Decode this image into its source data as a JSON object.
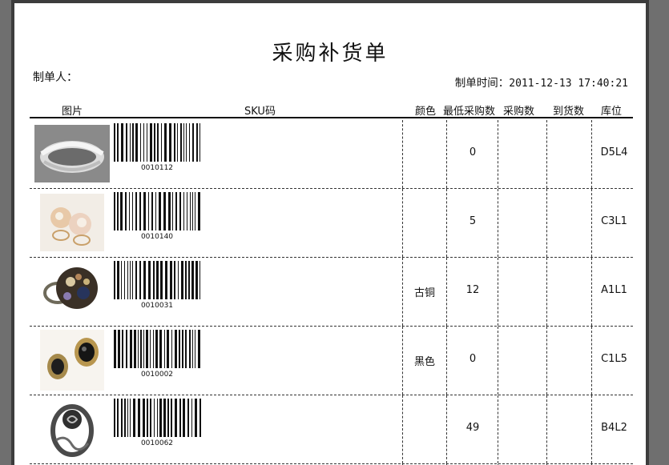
{
  "document": {
    "title": "采购补货单",
    "maker_label": "制单人",
    "maker_value": "",
    "time_label": "制单时间",
    "time_value": "2011-12-13 17:40:21"
  },
  "columns": {
    "image": "图片",
    "sku": "SKU码",
    "color": "颜色",
    "min_qty": "最低采购数",
    "purchase_qty": "采购数",
    "arrived_qty": "到货数",
    "location": "库位"
  },
  "rows": [
    {
      "sku": "0010112",
      "color": "",
      "min_qty": "0",
      "purchase_qty": "",
      "arrived_qty": "",
      "location": "D5L4",
      "photo_icon": "silver-mesh-ring-photo"
    },
    {
      "sku": "0010140",
      "color": "",
      "min_qty": "5",
      "purchase_qty": "",
      "arrived_qty": "",
      "location": "C3L1",
      "photo_icon": "pearl-flower-rings-photo"
    },
    {
      "sku": "0010031",
      "color": "古铜",
      "min_qty": "12",
      "purchase_qty": "",
      "arrived_qty": "",
      "location": "A1L1",
      "photo_icon": "jeweled-dome-ring-photo"
    },
    {
      "sku": "0010002",
      "color": "黑色",
      "min_qty": "0",
      "purchase_qty": "",
      "arrived_qty": "",
      "location": "C1L5",
      "photo_icon": "black-gem-ring-photo"
    },
    {
      "sku": "0010062",
      "color": "",
      "min_qty": "49",
      "purchase_qty": "",
      "arrived_qty": "",
      "location": "B4L2",
      "photo_icon": "rose-vine-ring-photo"
    }
  ],
  "colors": {
    "background": "#6f6f6f",
    "paper": "#ffffff",
    "ink": "#111111"
  }
}
